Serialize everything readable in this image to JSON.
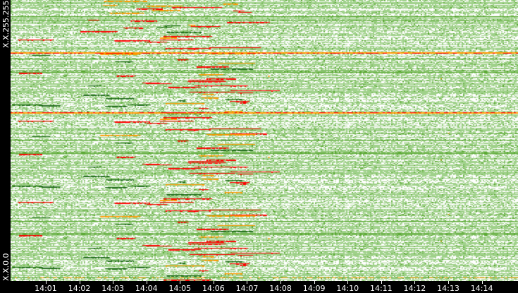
{
  "chart_data": {
    "type": "heatmap",
    "title": "",
    "xlabel": "",
    "ylabel": "",
    "y_labels": {
      "top": "X.X.255.255",
      "bottom": "X.X.0.0"
    },
    "x_ticks": [
      "14:01",
      "14:02",
      "14:03",
      "14:04",
      "14:05",
      "14:06",
      "14:07",
      "14:08",
      "14:09",
      "14:10",
      "14:11",
      "14:12",
      "14:13",
      "14:14"
    ],
    "x_range_minutes": [
      -1.05,
      14.08
    ],
    "activity_burst_minutes": [
      2.0,
      6.5
    ],
    "colors": {
      "background": "#ffffff",
      "low": "#9fd18a",
      "medium": "#5aa832",
      "dark": "#1f6b1a",
      "high": "#ff9900",
      "peak": "#ff0000",
      "frame": "#000000"
    }
  }
}
